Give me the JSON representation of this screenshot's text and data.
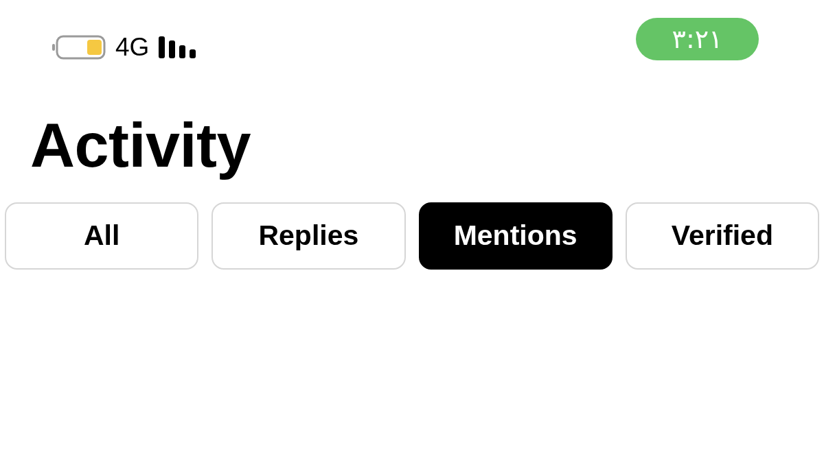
{
  "status_bar": {
    "network": "4G",
    "time": "٣:٢١"
  },
  "title": "Activity",
  "tabs": [
    {
      "label": "All",
      "selected": false
    },
    {
      "label": "Replies",
      "selected": false
    },
    {
      "label": "Mentions",
      "selected": true
    },
    {
      "label": "Verified",
      "selected": false
    }
  ]
}
